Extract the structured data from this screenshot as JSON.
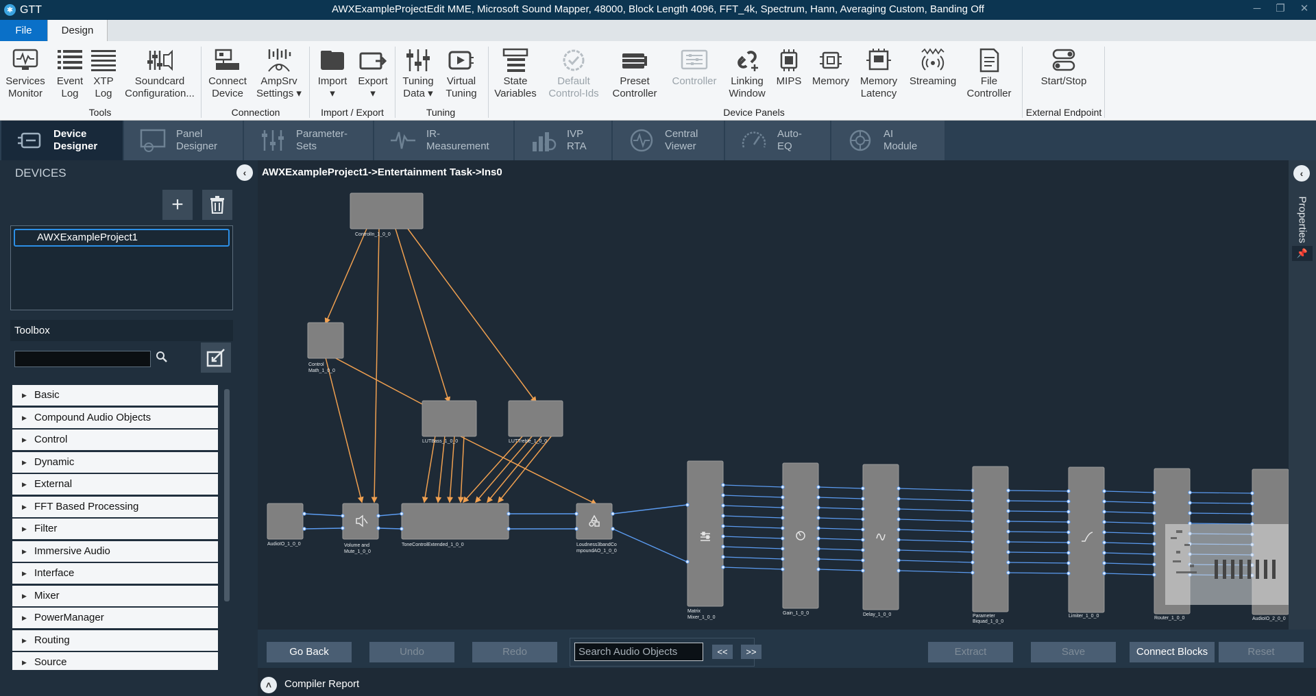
{
  "window": {
    "app_name": "GTT",
    "title": "AWXExampleProjectEdit MME, Microsoft Sound Mapper, 48000, Block Length 4096, FFT_4k, Spectrum, Hann, Averaging Custom, Banding Off"
  },
  "menu_tabs": [
    "File",
    "Design"
  ],
  "ribbon": {
    "buttons": [
      {
        "id": "services-monitor",
        "label": "Services Monitor"
      },
      {
        "id": "event-log",
        "label": "Event Log"
      },
      {
        "id": "xtp-log",
        "label": "XTP Log"
      },
      {
        "id": "soundcard-config",
        "label": "Soundcard Configuration..."
      },
      {
        "id": "connect-device",
        "label": "Connect Device"
      },
      {
        "id": "ampsrv-settings",
        "label": "AmpSrv Settings ▾"
      },
      {
        "id": "import",
        "label": "Import ▾"
      },
      {
        "id": "export",
        "label": "Export ▾"
      },
      {
        "id": "tuning-data",
        "label": "Tuning Data ▾"
      },
      {
        "id": "virtual-tuning",
        "label": "Virtual Tuning"
      },
      {
        "id": "state-variables",
        "label": "State Variables"
      },
      {
        "id": "default-control-ids",
        "label": "Default Control-Ids"
      },
      {
        "id": "preset-controller",
        "label": "Preset Controller"
      },
      {
        "id": "controller",
        "label": "Controller"
      },
      {
        "id": "linking-window",
        "label": "Linking Window"
      },
      {
        "id": "mips",
        "label": "MIPS"
      },
      {
        "id": "memory",
        "label": "Memory"
      },
      {
        "id": "memory-latency",
        "label": "Memory Latency"
      },
      {
        "id": "streaming",
        "label": "Streaming"
      },
      {
        "id": "file-controller",
        "label": "File Controller"
      },
      {
        "id": "start-stop",
        "label": "Start/Stop"
      }
    ],
    "groups": [
      "Tools",
      "Connection",
      "Import / Export",
      "Tuning",
      "Device Panels",
      "External Endpoint"
    ]
  },
  "module_tabs": [
    {
      "label": "Device Designer",
      "active": true
    },
    {
      "label": "Panel Designer"
    },
    {
      "label": "Parameter- Sets"
    },
    {
      "label": "IR- Measurement"
    },
    {
      "label": "IVP RTA"
    },
    {
      "label": "Central Viewer"
    },
    {
      "label": "Auto- EQ"
    },
    {
      "label": "AI Module"
    }
  ],
  "devices": {
    "header": "DEVICES",
    "items": [
      "AWXExampleProject1"
    ]
  },
  "toolbox": {
    "header": "Toolbox",
    "search_value": "",
    "categories": [
      "Basic",
      "Compound Audio Objects",
      "Control",
      "Dynamic",
      "External",
      "FFT Based Processing",
      "Filter",
      "Immersive Audio",
      "Interface",
      "Mixer",
      "PowerManager",
      "Routing",
      "Source"
    ]
  },
  "canvas": {
    "breadcrumb": "AWXExampleProject1->Entertainment Task->Ins0",
    "blocks": {
      "controlin": "ControlIn_1_0_0",
      "controlmath_1": "Control",
      "controlmath_2": "Math_1_0_0",
      "lutbass": "LUTBass_1_0_0",
      "luttreble": "LUTTreble_1_0_0",
      "audioio": "AudioIO_1_0_0",
      "volume_1": "Volume and",
      "volume_2": "Mute_1_0_0",
      "tonecontrol": "ToneControlExtended_1_0_0",
      "loudness_1": "Loudness3bandCo",
      "loudness_2": "mpoundAO_1_0_0",
      "matrix_1": "Matrix",
      "matrix_2": "Mixer_1_0_0",
      "gain": "Gain_1_0_0",
      "delay": "Delay_1_0_0",
      "biquad_1": "Parameter",
      "biquad_2": "Biquad_1_0_0",
      "limiter": "Limiter_1_0_0",
      "router": "Router_1_0_0",
      "audioio2": "AudioIO_2_0_0"
    }
  },
  "properties_label": "Properties",
  "bottom_bar": {
    "go_back": "Go Back",
    "undo": "Undo",
    "redo": "Redo",
    "search_placeholder": "Search Audio Objects",
    "prev": "<<",
    "next": ">>",
    "extract": "Extract",
    "save": "Save",
    "connect_blocks": "Connect Blocks",
    "reset": "Reset"
  },
  "compiler_report": "Compiler Report",
  "colors": {
    "titlebar": "#0c3551",
    "accent": "#0a70c8",
    "canvas": "#1e2a36",
    "control_wire": "#f0a050",
    "audio_wire": "#5b9bf0",
    "block": "#808080"
  }
}
